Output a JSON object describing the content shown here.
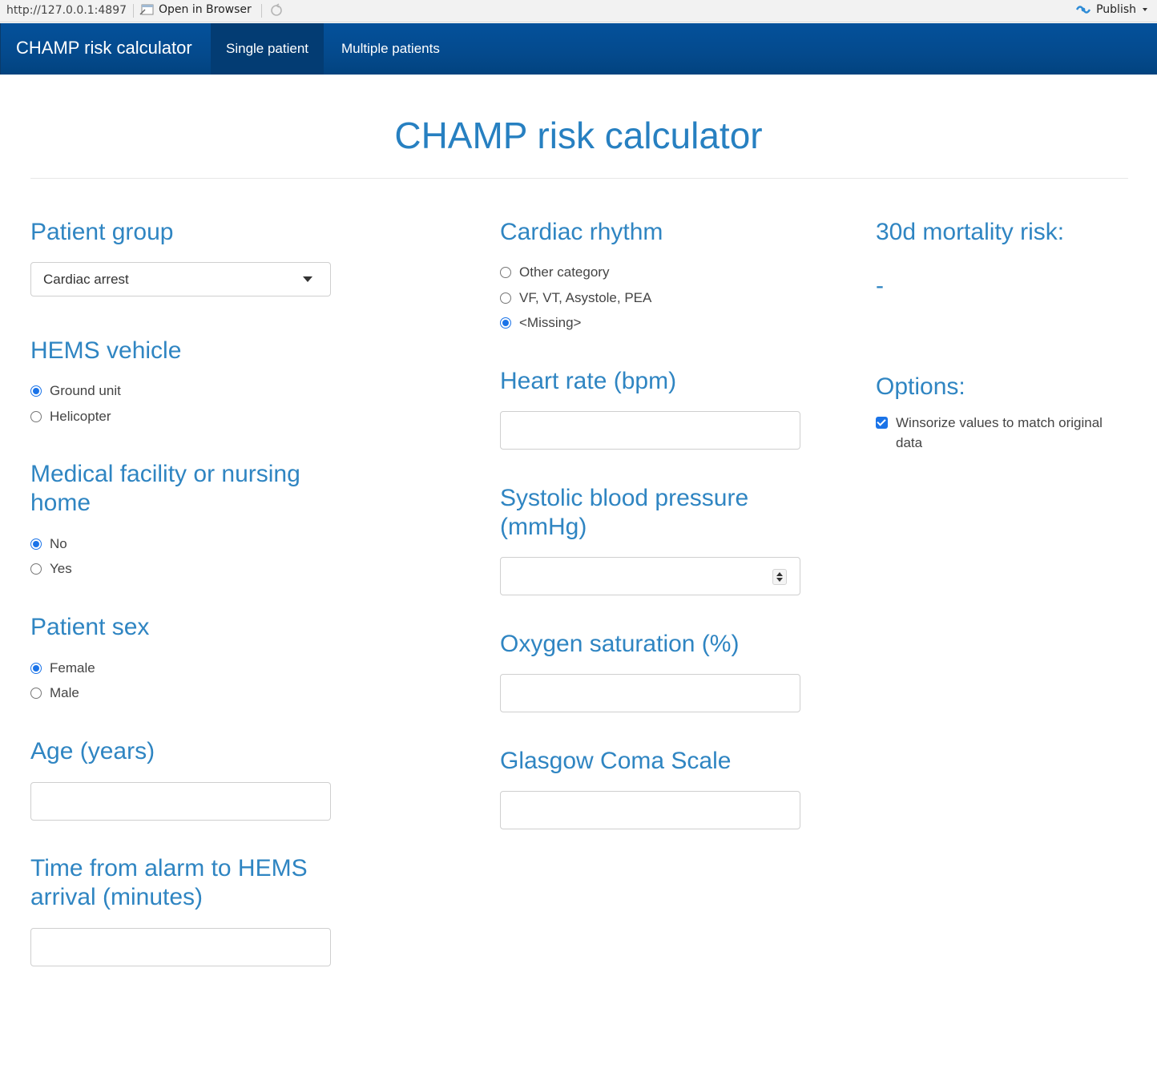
{
  "viewer": {
    "url": "http://127.0.0.1:4897",
    "open_in_browser": "Open in Browser",
    "publish": "Publish"
  },
  "navbar": {
    "brand": "CHAMP risk calculator",
    "tabs": [
      {
        "label": "Single patient",
        "active": true
      },
      {
        "label": "Multiple patients",
        "active": false
      }
    ]
  },
  "page": {
    "title": "CHAMP risk calculator"
  },
  "patient_group": {
    "heading": "Patient group",
    "selected": "Cardiac arrest"
  },
  "hems_vehicle": {
    "heading": "HEMS vehicle",
    "options": [
      {
        "label": "Ground unit",
        "selected": true
      },
      {
        "label": "Helicopter",
        "selected": false
      }
    ]
  },
  "medical_facility": {
    "heading_line1": "Medical facility or nursing",
    "heading_line2": "home",
    "options": [
      {
        "label": "No",
        "selected": true
      },
      {
        "label": "Yes",
        "selected": false
      }
    ]
  },
  "patient_sex": {
    "heading": "Patient sex",
    "options": [
      {
        "label": "Female",
        "selected": true
      },
      {
        "label": "Male",
        "selected": false
      }
    ]
  },
  "age": {
    "heading": "Age (years)",
    "value": ""
  },
  "time_alarm": {
    "heading_line1": "Time from alarm to HEMS",
    "heading_line2": "arrival (minutes)",
    "value": ""
  },
  "cardiac_rhythm": {
    "heading": "Cardiac rhythm",
    "options": [
      {
        "label": "Other category",
        "selected": false
      },
      {
        "label": "VF, VT, Asystole, PEA",
        "selected": false
      },
      {
        "label": "<Missing>",
        "selected": true
      }
    ]
  },
  "heart_rate": {
    "heading": "Heart rate (bpm)",
    "value": ""
  },
  "systolic_bp": {
    "heading_line1": "Systolic blood pressure",
    "heading_line2": "(mmHg)",
    "value": ""
  },
  "oxygen_saturation": {
    "heading": "Oxygen saturation (%)",
    "value": ""
  },
  "gcs": {
    "heading": "Glasgow Coma Scale",
    "value": ""
  },
  "mortality": {
    "heading": "30d mortality risk:",
    "value": "-"
  },
  "options": {
    "heading": "Options:",
    "winsorize": {
      "line1": "Winsorize values to match original",
      "line2": "data",
      "checked": true
    }
  },
  "colors": {
    "navbar": "#044a8d",
    "heading": "#2f85c2",
    "radio_accent": "#1a73e8"
  }
}
